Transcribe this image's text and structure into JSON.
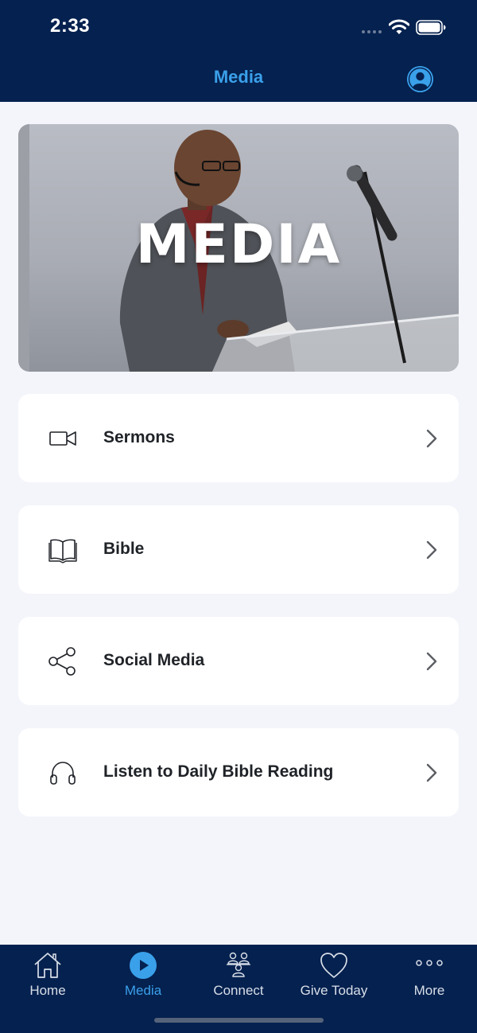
{
  "status_bar": {
    "time": "2:33"
  },
  "header": {
    "title": "Media"
  },
  "hero": {
    "title": "MEDIA"
  },
  "menu": {
    "items": [
      {
        "label": "Sermons",
        "icon": "video-camera-icon"
      },
      {
        "label": "Bible",
        "icon": "book-icon"
      },
      {
        "label": "Social Media",
        "icon": "share-icon"
      },
      {
        "label": "Listen to Daily Bible Reading",
        "icon": "headphones-icon"
      }
    ]
  },
  "tabs": [
    {
      "label": "Home",
      "icon": "home-icon",
      "active": false
    },
    {
      "label": "Media",
      "icon": "play-icon",
      "active": true
    },
    {
      "label": "Connect",
      "icon": "people-icon",
      "active": false
    },
    {
      "label": "Give Today",
      "icon": "heart-icon",
      "active": false
    },
    {
      "label": "More",
      "icon": "more-dots-icon",
      "active": false
    }
  ],
  "colors": {
    "nav_background": "#05214f",
    "accent": "#3aa0ea",
    "page_background": "#f3f5fa",
    "card_background": "#ffffff"
  }
}
